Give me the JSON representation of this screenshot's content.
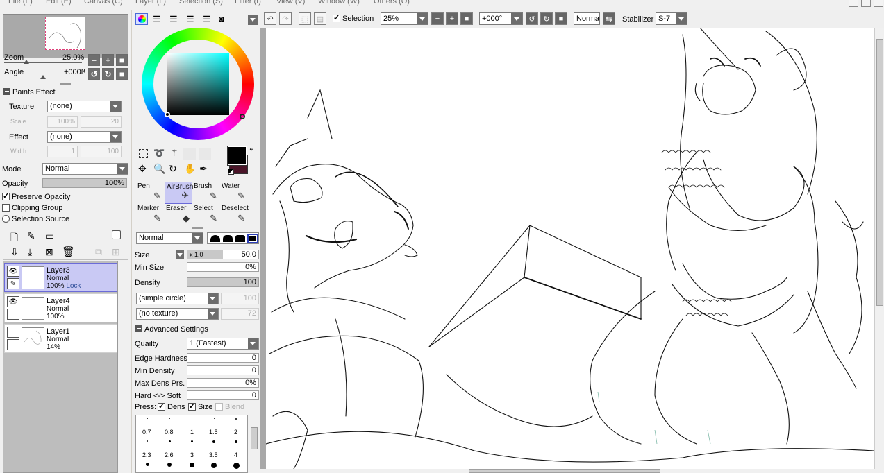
{
  "menu": [
    "File (F)",
    "Edit (E)",
    "Canvas (C)",
    "Layer (L)",
    "Selection (S)",
    "Filter (I)",
    "View (V)",
    "Window (W)",
    "Others (O)"
  ],
  "toolbar": {
    "selection_label": "Selection",
    "selection_checked": true,
    "zoom_value": "25%",
    "rotation_value": "+000°",
    "blend_mode": "Normal",
    "stabilizer_label": "Stabilizer",
    "stabilizer_value": "S-7"
  },
  "navigator": {
    "zoom_label": "Zoom",
    "zoom_value": "25.0%",
    "angle_label": "Angle",
    "angle_value": "+000ß"
  },
  "paints_effect": {
    "header": "Paints Effect",
    "texture_label": "Texture",
    "texture_value": "(none)",
    "scale_label": "Scale",
    "scale_value": "100%",
    "scale_num": "20",
    "effect_label": "Effect",
    "effect_value": "(none)",
    "width_label": "Width",
    "width_value": "1",
    "width_num": "100"
  },
  "layer_props": {
    "mode_label": "Mode",
    "mode_value": "Normal",
    "opacity_label": "Opacity",
    "opacity_value": "100%",
    "preserve_opacity": "Preserve Opacity",
    "clipping_group": "Clipping Group",
    "selection_source": "Selection Source"
  },
  "layers": [
    {
      "name": "Layer3",
      "mode": "Normal",
      "opacity": "100%",
      "lock": "Lock",
      "selected": true
    },
    {
      "name": "Layer4",
      "mode": "Normal",
      "opacity": "100%",
      "lock": "",
      "selected": false
    },
    {
      "name": "Layer1",
      "mode": "Normal",
      "opacity": "14%",
      "lock": "",
      "selected": false
    }
  ],
  "colors": {
    "foreground": "#000000",
    "background": "#4a1528",
    "selection_accent": "#c9c9f4"
  },
  "tools": {
    "row1": [
      "Pen",
      "AirBrush",
      "Brush",
      "Water"
    ],
    "row2": [
      "Marker",
      "Eraser",
      "Select",
      "Deselect"
    ],
    "selected": "AirBrush"
  },
  "brush": {
    "blend_value": "Normal",
    "size_label": "Size",
    "size_mult": "x 1.0",
    "size_value": "50.0",
    "min_size_label": "Min Size",
    "min_size_value": "0%",
    "density_label": "Density",
    "density_value": "100",
    "shape_value": "(simple circle)",
    "shape_num": "100",
    "texture_value": "(no texture)",
    "texture_num": "72",
    "advanced_header": "Advanced Settings",
    "quality_label": "Quailty",
    "quality_value": "1 (Fastest)",
    "edge_hardness_label": "Edge Hardness",
    "edge_hardness_value": "0",
    "min_density_label": "Min Density",
    "min_density_value": "0",
    "max_dens_label": "Max Dens Prs.",
    "max_dens_value": "0%",
    "hard_soft_label": "Hard <-> Soft",
    "hard_soft_value": "0",
    "press_label": "Press:",
    "press_dens": "Dens",
    "press_size": "Size",
    "press_blend": "Blend",
    "sizes_row1": [
      "0.7",
      "0.8",
      "1",
      "1.5",
      "2"
    ],
    "sizes_row2": [
      "2.3",
      "2.6",
      "3",
      "3.5",
      "4"
    ]
  }
}
